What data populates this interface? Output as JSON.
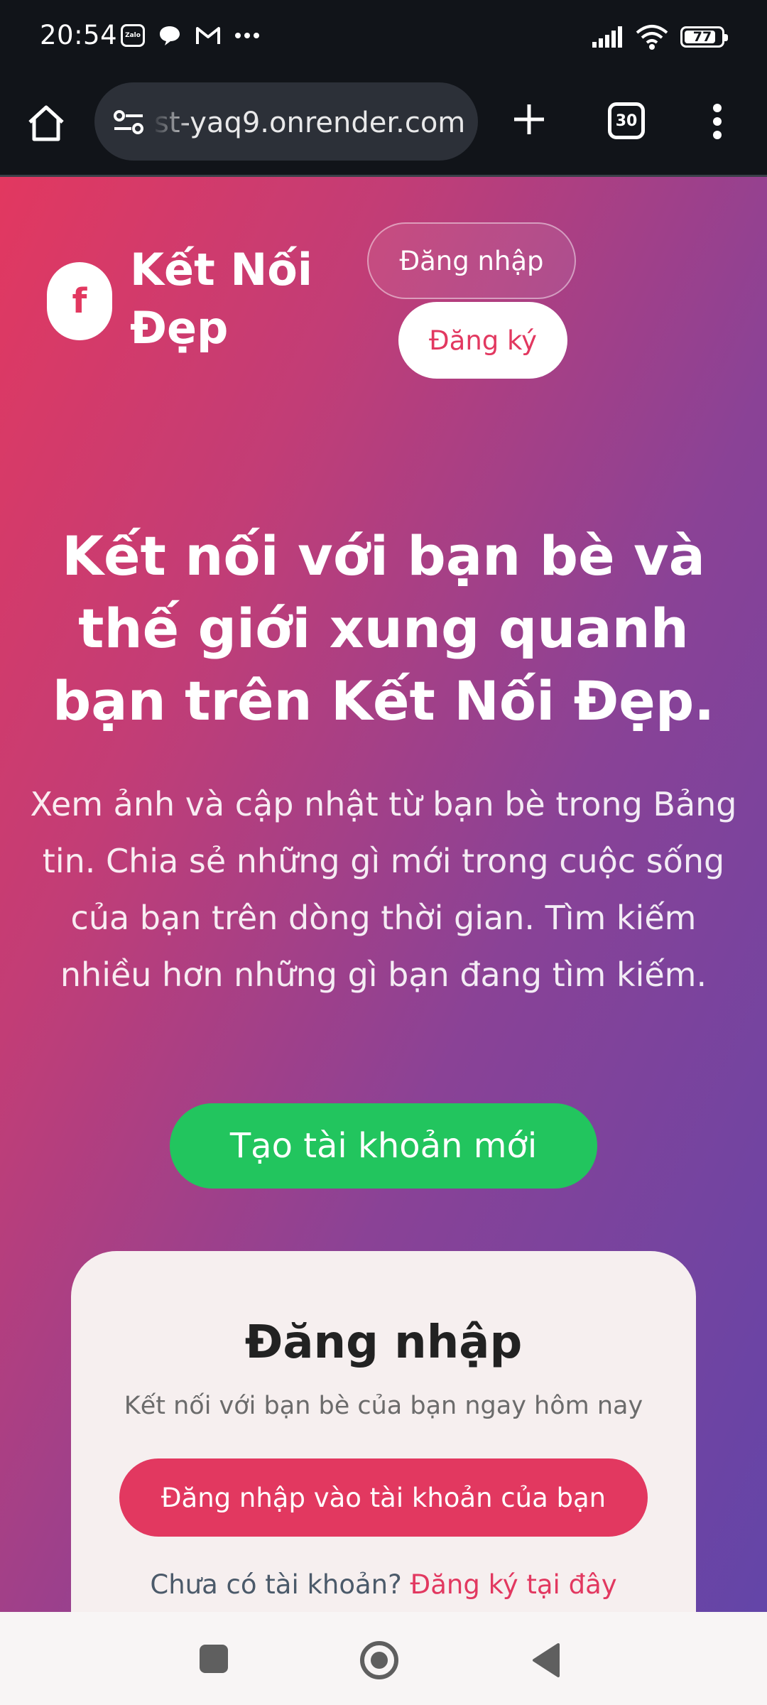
{
  "status_bar": {
    "time": "20:54",
    "zalo_label": "Zalo",
    "battery": "77"
  },
  "browser": {
    "url": "st-yaq9.onrender.com",
    "tab_count": "30"
  },
  "header": {
    "logo_letter": "f",
    "brand_name": "Kết Nối Đẹp",
    "login_label": "Đăng nhập",
    "register_label": "Đăng ký"
  },
  "hero": {
    "title": "Kết nối với bạn bè và thế giới xung quanh bạn trên Kết Nối Đẹp.",
    "subtitle": "Xem ảnh và cập nhật từ bạn bè trong Bảng tin. Chia sẻ những gì mới trong cuộc sống của bạn trên dòng thời gian. Tìm kiếm nhiều hơn những gì bạn đang tìm kiếm.",
    "create_account_label": "Tạo tài khoản mới"
  },
  "login_card": {
    "title": "Đăng nhập",
    "subtitle": "Kết nối với bạn bè của bạn ngay hôm nay",
    "button_label": "Đăng nhập vào tài khoản của bạn",
    "footer_text": "Chưa có tài khoản?",
    "footer_link": "Đăng ký tại đây"
  },
  "colors": {
    "accent": "#e23860",
    "gradient_end": "#6345a8",
    "cta_green": "#22c55e",
    "card_bg": "#f6efef"
  }
}
